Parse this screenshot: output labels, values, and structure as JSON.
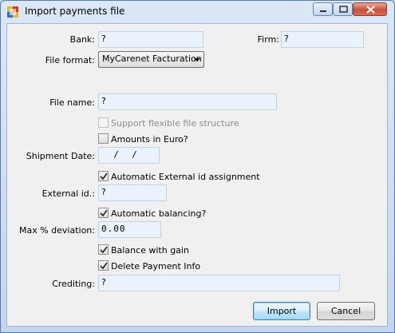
{
  "window": {
    "title": "Import payments file"
  },
  "form": {
    "bank": {
      "label": "Bank:",
      "value": "?"
    },
    "firm": {
      "label": "Firm:",
      "value": "?"
    },
    "file_format": {
      "label": "File format:",
      "selected": "MyCarenet Facturation"
    },
    "file_name": {
      "label": "File name:",
      "value": "?"
    },
    "support_flexible": {
      "label": "Support flexible file structure",
      "checked": false,
      "enabled": false
    },
    "amounts_in_euro": {
      "label": "Amounts in Euro?",
      "checked": false
    },
    "shipment_date": {
      "label": "Shipment Date:",
      "value": "  /  /"
    },
    "auto_external_id": {
      "label": "Automatic External id assignment",
      "checked": true
    },
    "external_id": {
      "label": "External id.:",
      "value": "?"
    },
    "auto_balancing": {
      "label": "Automatic balancing?",
      "checked": true
    },
    "max_deviation": {
      "label": "Max % deviation:",
      "value": "0.00"
    },
    "balance_with_gain": {
      "label": "Balance with gain",
      "checked": true
    },
    "delete_payment_info": {
      "label": "Delete Payment Info",
      "checked": true
    },
    "crediting": {
      "label": "Crediting:",
      "value": "?"
    }
  },
  "buttons": {
    "import": "Import",
    "cancel": "Cancel"
  }
}
